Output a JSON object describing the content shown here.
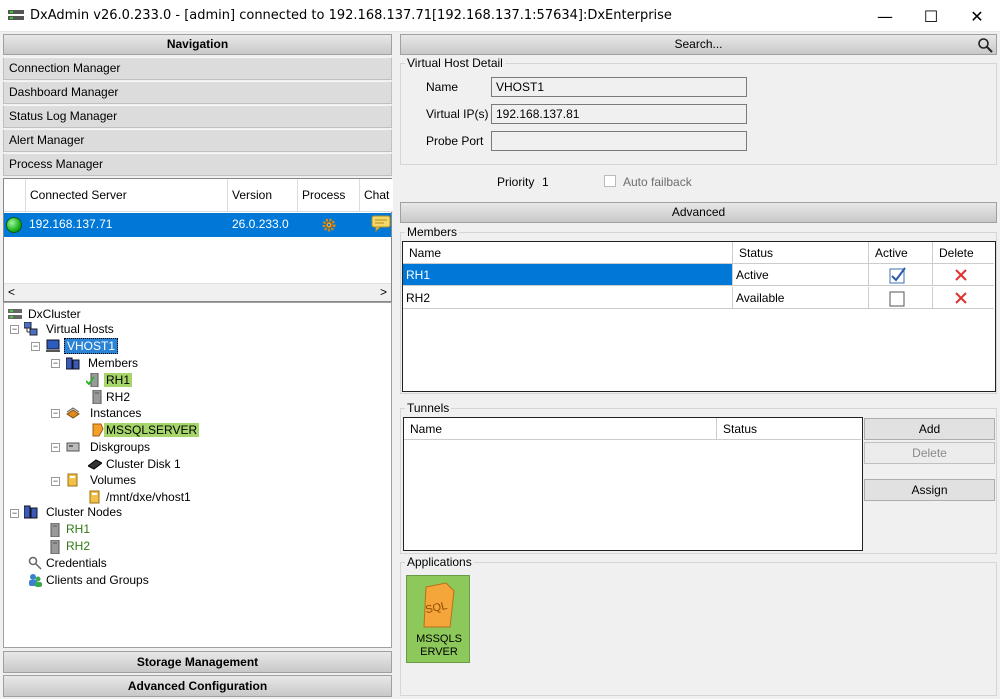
{
  "window": {
    "title": "DxAdmin v26.0.233.0 - [admin] connected to 192.168.137.71[192.168.137.1:57634]:DxEnterprise",
    "minimize": "—",
    "maximize": "☐",
    "close": "✕"
  },
  "nav": {
    "header": "Navigation",
    "items": [
      "Connection Manager",
      "Dashboard Manager",
      "Status Log Manager",
      "Alert Manager",
      "Process Manager"
    ],
    "footer_storage": "Storage Management",
    "footer_advanced": "Advanced Configuration"
  },
  "servers": {
    "columns": [
      "Connected Server",
      "Version",
      "Process",
      "Chat"
    ],
    "rows": [
      {
        "server": "192.168.137.71",
        "version": "26.0.233.0",
        "status_color": "#1db31d"
      }
    ],
    "scroll_left": "<",
    "scroll_right": ">"
  },
  "tree": {
    "root": "DxCluster",
    "virtual_hosts": "Virtual Hosts",
    "vhost": "VHOST1",
    "members": "Members",
    "member1": "RH1",
    "member2": "RH2",
    "instances": "Instances",
    "instance1": "MSSQLSERVER",
    "diskgroups": "Diskgroups",
    "disk1": "Cluster Disk 1",
    "volumes": "Volumes",
    "volume1": "/mnt/dxe/vhost1",
    "cluster_nodes": "Cluster Nodes",
    "node1": "RH1",
    "node2": "RH2",
    "credentials": "Credentials",
    "clients": "Clients and Groups"
  },
  "search": {
    "label": "Search..."
  },
  "detail": {
    "group_title": "Virtual Host Detail",
    "name_label": "Name",
    "name_value": "VHOST1",
    "vip_label": "Virtual IP(s)",
    "vip_value": "192.168.137.81",
    "probe_label": "Probe Port",
    "probe_value": "",
    "priority_label": "Priority",
    "priority_value": "1",
    "autofailback_label": "Auto failback",
    "advanced_label": "Advanced"
  },
  "members": {
    "group_title": "Members",
    "columns": [
      "Name",
      "Status",
      "Active",
      "Delete"
    ],
    "rows": [
      {
        "name": "RH1",
        "status": "Active",
        "active": true
      },
      {
        "name": "RH2",
        "status": "Available",
        "active": false
      }
    ]
  },
  "tunnels": {
    "group_title": "Tunnels",
    "columns": [
      "Name",
      "Status"
    ],
    "add": "Add",
    "delete": "Delete",
    "assign": "Assign"
  },
  "applications": {
    "group_title": "Applications",
    "tile_label": "MSSQLS ERVER",
    "tile_line1": "MSSQLS",
    "tile_line2": "ERVER",
    "tile_icon_text": "SQL"
  },
  "colors": {
    "selection": "#0078d7",
    "tree_green": "#a6d66a",
    "delete_red": "#e03030"
  }
}
